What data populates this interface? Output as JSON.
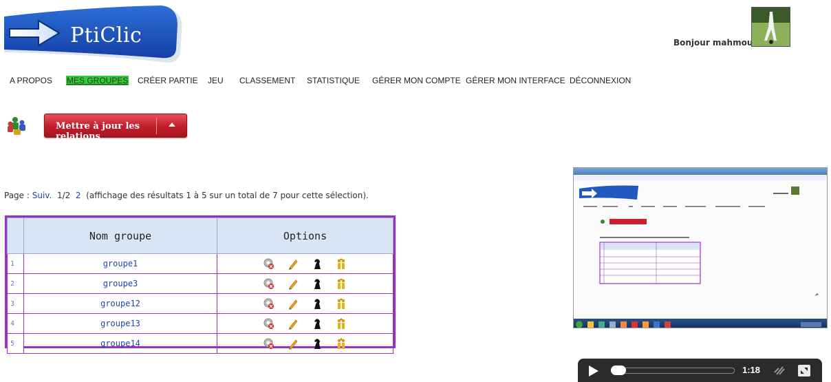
{
  "logo": {
    "text": "PtiClic"
  },
  "user": {
    "greeting": "Bonjour mahmoud"
  },
  "nav": {
    "items": [
      {
        "label": "A PROPOS"
      },
      {
        "label": "MES GROUPES"
      },
      {
        "label": "CRÉER PARTIE"
      },
      {
        "label": "JEU"
      },
      {
        "label": "CLASSEMENT"
      },
      {
        "label": "STATISTIQUE"
      },
      {
        "label": "GÉRER MON COMPTE"
      },
      {
        "label": "GÉRER MON INTERFACE"
      },
      {
        "label": "DÉCONNEXION"
      }
    ],
    "active": "MES GROUPES"
  },
  "update_button": {
    "label": "Mettre à jour les relations"
  },
  "pager": {
    "prefix": "Page :",
    "next": "Suiv.",
    "current": "1/2",
    "page2": "2",
    "summary": "(affichage des résultats 1 à 5 sur un total de 7 pour cette sélection)."
  },
  "table": {
    "headers": [
      "Nom groupe",
      "Options"
    ],
    "rows": [
      {
        "num": "1",
        "name": "groupe1"
      },
      {
        "num": "2",
        "name": "groupe3"
      },
      {
        "num": "3",
        "name": "groupe12"
      },
      {
        "num": "4",
        "name": "groupe13"
      },
      {
        "num": "5",
        "name": "groupe14"
      }
    ],
    "option_icons": [
      "delete-gear-icon",
      "pencil-icon",
      "chess-knight-icon",
      "people-up-icon"
    ]
  },
  "video": {
    "time": "1:18"
  },
  "colors": {
    "accent_purple": "#9b30c8",
    "active_nav": "#33cc33",
    "button_red": "#c51f2c",
    "link_blue": "#2244aa"
  }
}
